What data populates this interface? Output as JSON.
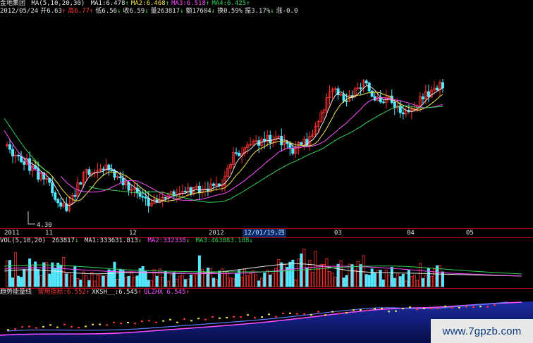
{
  "header": {
    "stock_name": "金地集团",
    "ma_label": "MA(5,10,20,30)",
    "ma_values": [
      {
        "label": "MA1:6.478",
        "arrow": "↑",
        "color": "#e6e6e6"
      },
      {
        "label": "MA2:6.468",
        "arrow": "↑",
        "color": "#f3e64a"
      },
      {
        "label": "MA3:6.518",
        "arrow": "↑",
        "color": "#ff4cff"
      },
      {
        "label": "MA4:6.425",
        "arrow": "↑",
        "color": "#35d35d"
      }
    ],
    "quote_fields": [
      {
        "label": "2012/05/24",
        "color": "#e6e6e6"
      },
      {
        "label": "开6.63",
        "arrow": "↑",
        "color": "#e6e6e6"
      },
      {
        "label": "高6.77",
        "arrow": "↑",
        "color": "#ff3b3b"
      },
      {
        "label": "低6.56",
        "arrow": "↓",
        "color": "#e6e6e6"
      },
      {
        "label": "收6.59",
        "arrow": "↓",
        "color": "#e6e6e6"
      },
      {
        "label": "量263817",
        "arrow": "↓",
        "color": "#e6e6e6"
      },
      {
        "label": "额17604",
        "arrow": "↓",
        "color": "#e6e6e6"
      },
      {
        "label": "换0.59%",
        "color": "#e6e6e6"
      },
      {
        "label": "振3.17%",
        "arrow": "↓",
        "color": "#e6e6e6"
      },
      {
        "label": "涨-0.0",
        "color": "#e6e6e6"
      }
    ]
  },
  "price_chart": {
    "low_annotation": "4.30"
  },
  "timeline": {
    "ticks": [
      "2011",
      "11",
      "12",
      "2012",
      "03",
      "04",
      "05"
    ],
    "cursor_label": "12/01/19,四"
  },
  "volume": {
    "label": "VOL(5,10,20)",
    "value": "263817",
    "value_arrow": "↓",
    "ma1": "MA1:333631.813",
    "ma1_arrow": "↓",
    "ma2": "MA2:332338",
    "ma2_arrow": "↓",
    "ma3": "MA3:463883.188",
    "ma3_arrow": "↓"
  },
  "indicator": {
    "name": "趋势能量线",
    "fields": [
      {
        "label": "常用指标:6.552",
        "arrow": "↑",
        "color": "#ff3b3b"
      },
      {
        "label": "XKSH__:6.545",
        "arrow": "↑",
        "color": "#e6e6e6"
      },
      {
        "label": "QLZHX 6.545",
        "arrow": "↑",
        "color": "#ff4cff"
      }
    ]
  },
  "watermark": "www.7gpzb.com",
  "colors": {
    "up": "#ff3030",
    "down": "#55e7ff",
    "ma1": "#e6e6e6",
    "ma2": "#f3e64a",
    "ma3": "#ff4cff",
    "ma4": "#35d35d",
    "ind_fill": "#0a1a7a"
  }
}
